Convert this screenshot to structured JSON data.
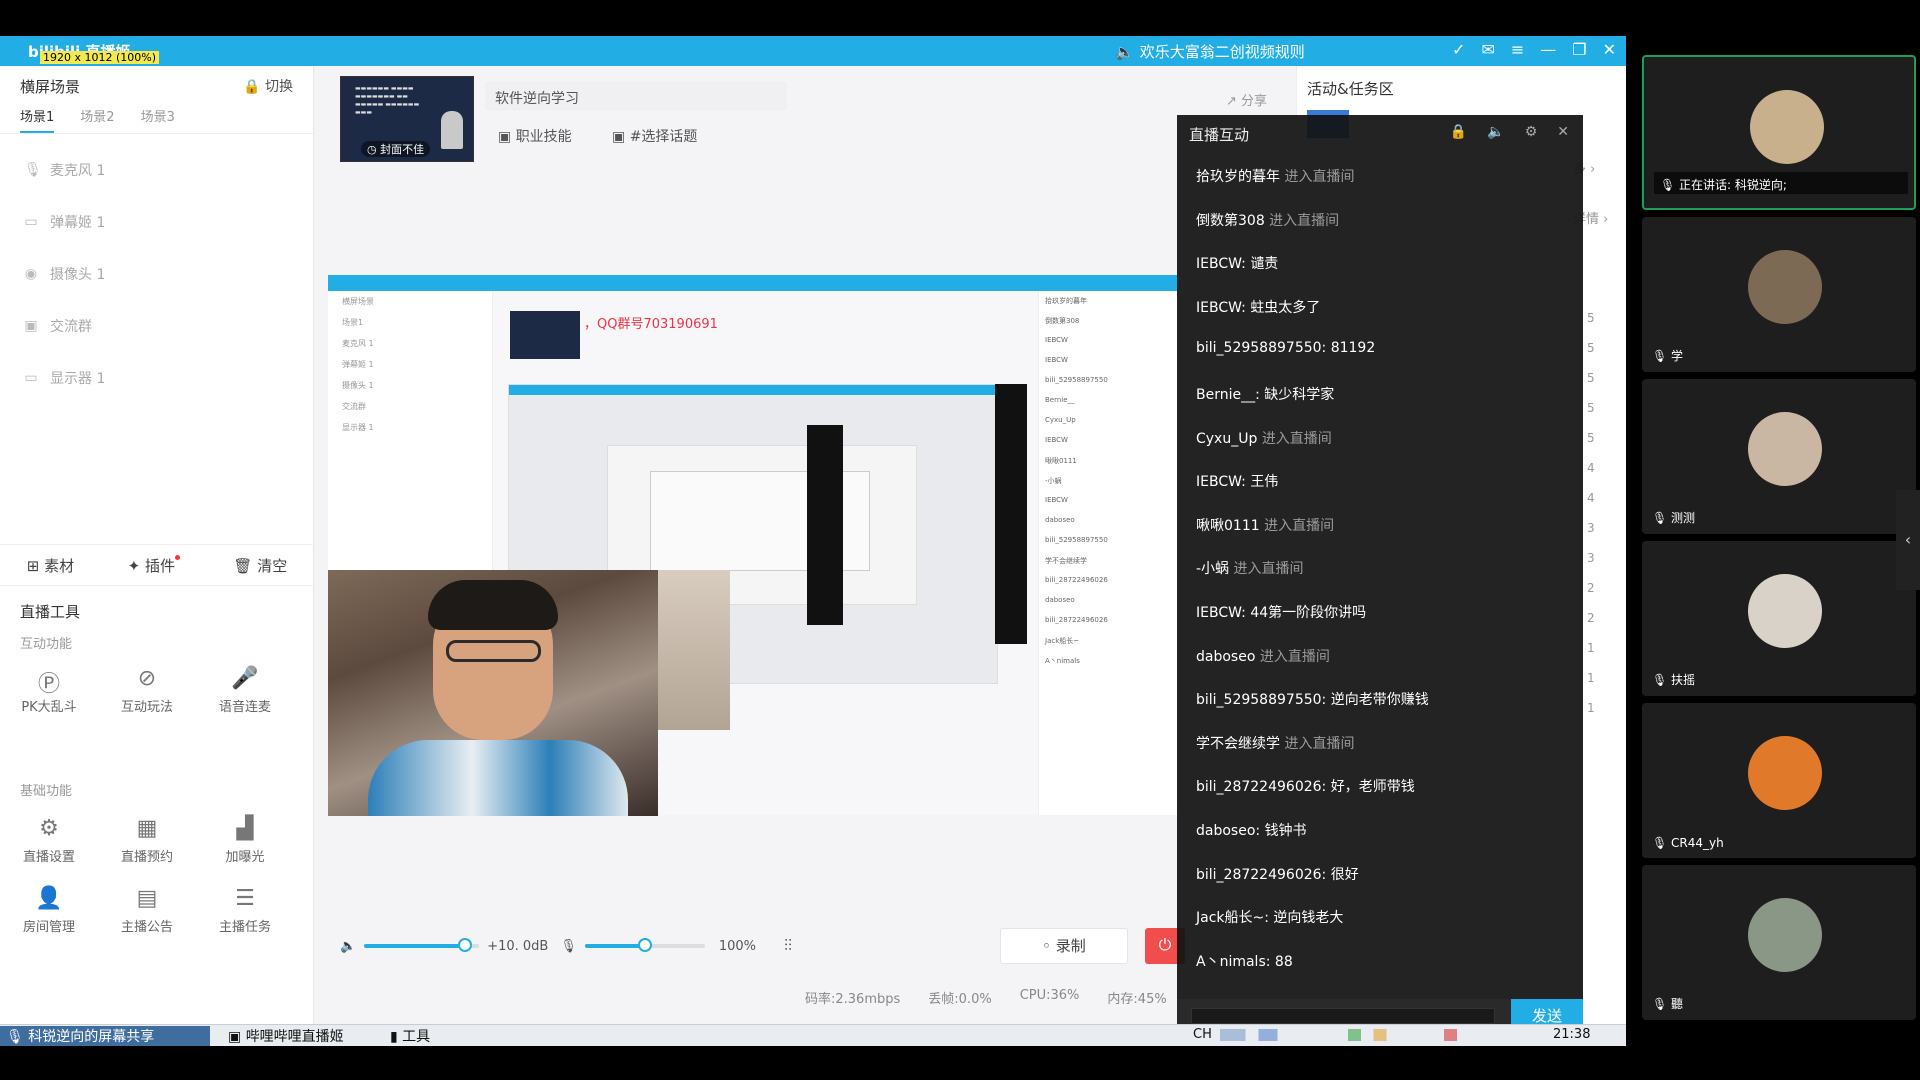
{
  "titlebar": {
    "logo": "bilibili 直播姬",
    "resolution_badge": "1920 x 1012 (100%)",
    "notice": "欢乐大富翁二创视频规则",
    "notice_icon": "speaker-icon",
    "controls": [
      "check-icon",
      "mail-icon",
      "menu-icon",
      "minimize-icon",
      "restore-icon",
      "close-icon"
    ]
  },
  "left": {
    "header": "横屏场景",
    "switch_label": "切换",
    "tabs": [
      "场景1",
      "场景2",
      "场景3"
    ],
    "sources": [
      {
        "label": "麦克风 1",
        "icon": "mic-icon"
      },
      {
        "label": "弹幕姬 1",
        "icon": "danmaku-icon"
      },
      {
        "label": "摄像头 1",
        "icon": "camera-icon"
      },
      {
        "label": "交流群",
        "icon": "group-icon"
      },
      {
        "label": "显示器 1",
        "icon": "monitor-icon"
      }
    ],
    "toolbar": {
      "material": "素材",
      "plugin": "插件",
      "clear": "清空"
    },
    "live_tools_title": "直播工具",
    "interactive_title": "互动功能",
    "interactive": [
      {
        "label": "PK大乱斗",
        "icon": "pk-icon"
      },
      {
        "label": "互动玩法",
        "icon": "game-icon"
      },
      {
        "label": "语音连麦",
        "icon": "voice-icon"
      }
    ],
    "basic_title": "基础功能",
    "basic": [
      {
        "label": "直播设置",
        "icon": "settings-icon"
      },
      {
        "label": "直播预约",
        "icon": "calendar-icon"
      },
      {
        "label": "加曝光",
        "icon": "chart-icon"
      },
      {
        "label": "房间管理",
        "icon": "users-icon"
      },
      {
        "label": "主播公告",
        "icon": "notice-icon"
      },
      {
        "label": "主播任务",
        "icon": "task-icon"
      }
    ]
  },
  "room": {
    "cover_label": "封面不佳",
    "title": "软件逆向学习",
    "category": "职业技能",
    "topic": "#选择话题",
    "share": "分享"
  },
  "preview": {
    "qq_text": "，QQ群号703190691"
  },
  "audio": {
    "volume_db": "+10. 0dB",
    "volume_level": 0.88,
    "mic_percent": "100%",
    "mic_level": 0.5,
    "record": "录制"
  },
  "status": {
    "bitrate": "码率:2.36mbps",
    "dropped": "丢帧:0.0%",
    "cpu": "CPU:36%",
    "memory": "内存:45%"
  },
  "activity": {
    "title": "活动&任务区",
    "more": "多",
    "detail": "详情",
    "rank_numbers": [
      "5",
      "5",
      "5",
      "5",
      "5",
      "4",
      "4",
      "3",
      "3",
      "2",
      "2",
      "1",
      "1",
      "1"
    ]
  },
  "chat": {
    "title": "直播互动",
    "icons": [
      "lock-icon",
      "volume-icon",
      "gear-icon",
      "close-icon"
    ],
    "enter_suffix": "进入直播间",
    "send": "发送",
    "messages": [
      {
        "user": "拾玖岁的暮年",
        "text": "",
        "enter": true
      },
      {
        "user": "倒数第308",
        "text": "",
        "enter": true
      },
      {
        "user": "IEBCW",
        "text": "谴责",
        "enter": false
      },
      {
        "user": "IEBCW",
        "text": "蛀虫太多了",
        "enter": false
      },
      {
        "user": "bili_52958897550",
        "text": "81192",
        "enter": false
      },
      {
        "user": "Bernie__",
        "text": "缺少科学家",
        "enter": false
      },
      {
        "user": "Cyxu_Up",
        "text": "",
        "enter": true
      },
      {
        "user": "IEBCW",
        "text": "王伟",
        "enter": false
      },
      {
        "user": "啾啾0111",
        "text": "",
        "enter": true
      },
      {
        "user": "-小蜗",
        "text": "",
        "enter": true
      },
      {
        "user": "IEBCW",
        "text": "44第一阶段你讲吗",
        "enter": false
      },
      {
        "user": "daboseo",
        "text": "",
        "enter": true
      },
      {
        "user": "bili_52958897550",
        "text": "逆向老带你赚钱",
        "enter": false
      },
      {
        "user": "学不会继续学",
        "text": "",
        "enter": true
      },
      {
        "user": "bili_28722496026",
        "text": "好，老师带钱",
        "enter": false
      },
      {
        "user": "daboseo",
        "text": "钱钟书",
        "enter": false
      },
      {
        "user": "bili_28722496026",
        "text": "很好",
        "enter": false
      },
      {
        "user": "Jack船长~",
        "text": "逆向钱老大",
        "enter": false
      },
      {
        "user": "A丶nimals",
        "text": "88",
        "enter": false
      }
    ]
  },
  "taskbar": {
    "share_item": "科锐逆向的屏幕共享",
    "bili_item": "哔哩哔哩直播姬",
    "tool_item": "工具",
    "lang": "CH",
    "clock": "21:38"
  },
  "participants": {
    "speaking_prefix": "正在讲话: 科锐逆向;",
    "cards": [
      {
        "name": "",
        "speaking": true,
        "color": "#c8b08c"
      },
      {
        "name": "学",
        "speaking": false,
        "color": "#7d6a55"
      },
      {
        "name": "测测",
        "speaking": false,
        "color": "#c9b7a3"
      },
      {
        "name": "扶摇",
        "speaking": false,
        "color": "#d8d2c8"
      },
      {
        "name": "CR44_yh",
        "speaking": false,
        "color": "#e07a2a"
      },
      {
        "name": "聽",
        "speaking": false,
        "color": "#8a9686"
      }
    ]
  }
}
